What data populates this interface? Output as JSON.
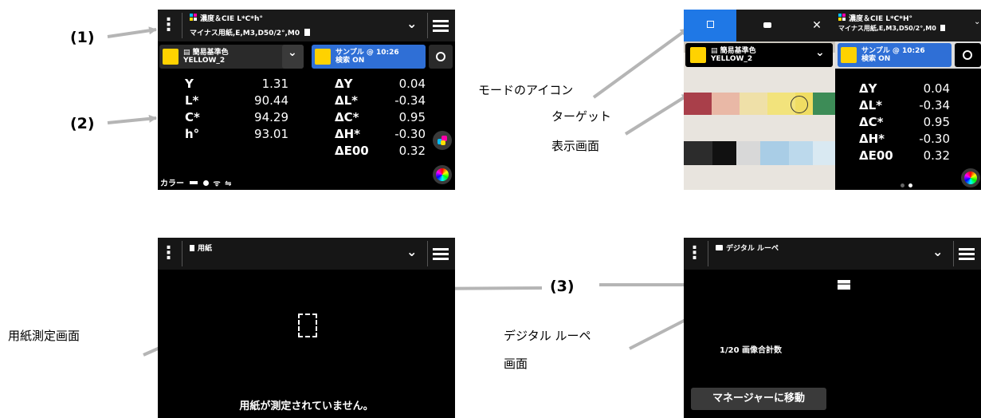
{
  "annotations": {
    "label1": "(1)",
    "label2": "(2)",
    "label3": "(3)",
    "mode_icon": "モードのアイコン",
    "target_line1": "ターゲット",
    "target_line2": "表示画面",
    "paper_screen": "用紙測定画面",
    "loupe_line1": "デジタル ルーペ",
    "loupe_line2": "画面"
  },
  "screen_color": {
    "header": {
      "title": "濃度＆CIE L*C*h°",
      "subtitle": "マイナス用紙,E,M3,D50/2°,M0"
    },
    "reference": {
      "line1": "簡易基準色",
      "line2": "YELLOW_2"
    },
    "sample": {
      "line1": "サンプル @ 10:26",
      "line2": "検索 ON"
    },
    "measurements": [
      {
        "label": "Y",
        "value": "1.31"
      },
      {
        "label": "L*",
        "value": "90.44"
      },
      {
        "label": "C*",
        "value": "94.29"
      },
      {
        "label": "h°",
        "value": "93.01"
      }
    ],
    "deltas": [
      {
        "label": "ΔY",
        "value": "0.04"
      },
      {
        "label": "ΔL*",
        "value": "-0.34"
      },
      {
        "label": "ΔC*",
        "value": "0.95"
      },
      {
        "label": "ΔH*",
        "value": "-0.30"
      },
      {
        "label": "ΔE00",
        "value": "0.32"
      }
    ],
    "footer_label": "カラー"
  },
  "screen_target": {
    "header": {
      "title": "濃度＆CIE L*C*H°",
      "subtitle": "マイナス用紙,E,M3,D50/2°,M0"
    },
    "reference": {
      "line1": "簡易基準色",
      "line2": "YELLOW_2"
    },
    "sample": {
      "line1": "サンプル @ 10:26",
      "line2": "検索 ON"
    },
    "deltas": [
      {
        "label": "ΔY",
        "value": "0.04"
      },
      {
        "label": "ΔL*",
        "value": "-0.34"
      },
      {
        "label": "ΔC*",
        "value": "0.95"
      },
      {
        "label": "ΔH*",
        "value": "-0.30"
      },
      {
        "label": "ΔE00",
        "value": "0.32"
      }
    ]
  },
  "screen_paper": {
    "header_title": "用紙",
    "message": "用紙が測定されていません。"
  },
  "screen_loupe": {
    "header_title": "デジタル ルーペ",
    "count": "1/20 画像合計数",
    "manager_button": "マネージャーに移動"
  },
  "colors": {
    "swatch": "#ffd200",
    "sample_blue": "#2f6fd6",
    "tab_blue": "#1f78e6",
    "arrow_gray": "#b5b5b5"
  }
}
